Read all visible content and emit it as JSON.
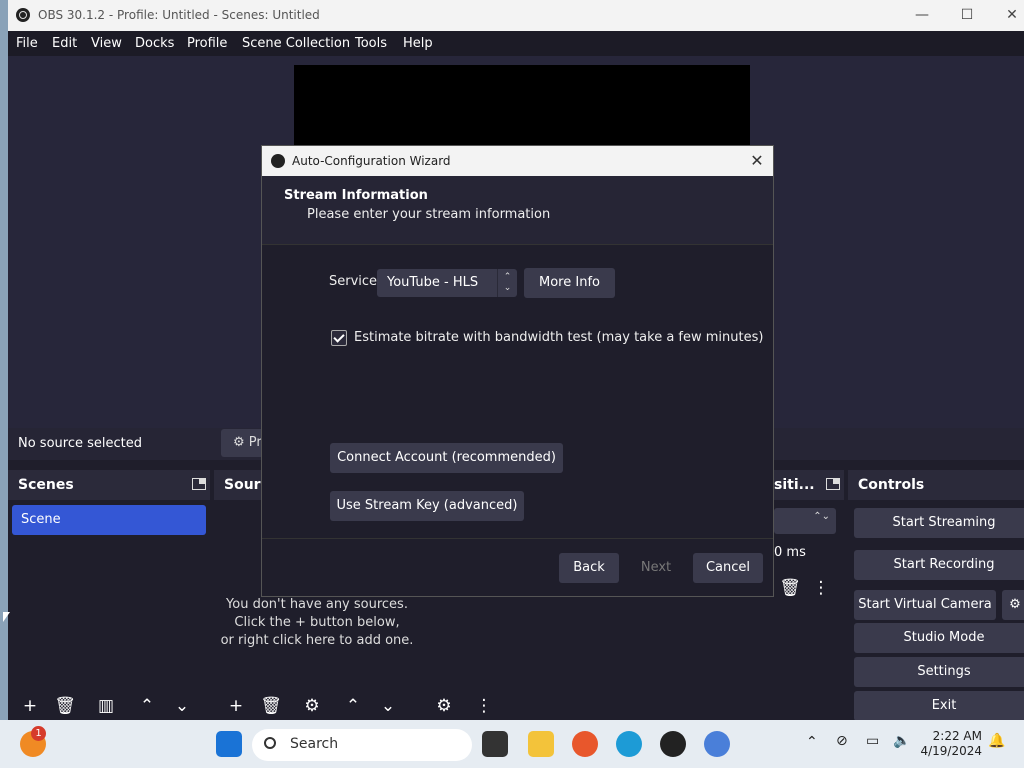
{
  "window": {
    "title": "OBS 30.1.2 - Profile: Untitled - Scenes: Untitled",
    "minimize": "—",
    "maximize": "☐",
    "close": "✕"
  },
  "menu": [
    "File",
    "Edit",
    "View",
    "Docks",
    "Profile",
    "Scene Collection",
    "Tools",
    "Help"
  ],
  "source_bar": {
    "no_source": "No source selected",
    "properties_partial": "Pr"
  },
  "docks": {
    "scenes": {
      "title": "Scenes",
      "items": [
        "Scene"
      ]
    },
    "sources": {
      "title_partial": "Sourc",
      "empty_line1": "You don't have any sources.",
      "empty_line2": "Click the + button below,",
      "empty_line3": "or right click here to add one."
    },
    "transitions": {
      "title_partial": "siti...",
      "duration_partial": "0 ms"
    },
    "controls": {
      "title": "Controls",
      "start_streaming": "Start Streaming",
      "start_recording": "Start Recording",
      "start_virtual_camera": "Start Virtual Camera",
      "studio_mode": "Studio Mode",
      "settings": "Settings",
      "exit": "Exit"
    }
  },
  "dialog": {
    "title": "Auto-Configuration Wizard",
    "close": "✕",
    "heading": "Stream Information",
    "subheading": "Please enter your stream information",
    "service_label": "Service",
    "service_value": "YouTube - HLS",
    "more_info": "More Info",
    "estimate_label": "Estimate bitrate with bandwidth test (may take a few minutes)",
    "estimate_checked": true,
    "connect_account": "Connect Account (recommended)",
    "use_stream_key": "Use Stream Key (advanced)",
    "back": "Back",
    "next": "Next",
    "cancel": "Cancel"
  },
  "taskbar": {
    "search_placeholder": "Search",
    "time": "2:22 AM",
    "date": "4/19/2024",
    "notification_badge": "1"
  },
  "colors": {
    "accent": "#3457d5",
    "panel": "#1f1e2b",
    "button": "#3a3a4c"
  }
}
